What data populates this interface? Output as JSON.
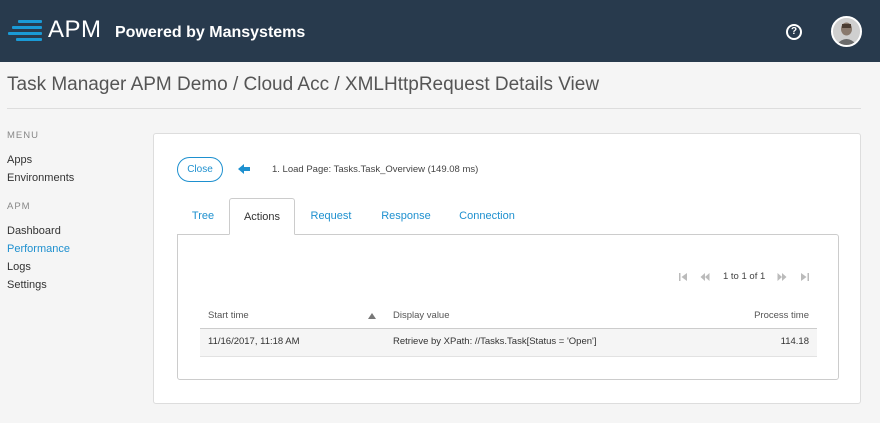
{
  "header": {
    "logo_text": "APM",
    "tagline": "Powered by Mansystems",
    "help_icon": "?",
    "brand_color": "#283a4d",
    "accent_color": "#1a9ad6"
  },
  "page": {
    "title": "Task Manager APM Demo / Cloud Acc / XMLHttpRequest Details View"
  },
  "sidebar": {
    "sections": [
      {
        "heading": "MENU",
        "items": [
          "Apps",
          "Environments"
        ]
      },
      {
        "heading": "APM",
        "items": [
          "Dashboard",
          "Performance",
          "Logs",
          "Settings"
        ]
      }
    ],
    "active_item": "Performance"
  },
  "details": {
    "close_label": "Close",
    "breadcrumb": "1. Load Page: Tasks.Task_Overview (149.08 ms)",
    "tabs": [
      "Tree",
      "Actions",
      "Request",
      "Response",
      "Connection"
    ],
    "active_tab": "Actions",
    "pager": {
      "text": "1 to 1 of 1"
    },
    "table": {
      "columns": [
        "Start time",
        "Display value",
        "Process time"
      ],
      "sorted_column": "Start time",
      "sort_direction": "ascending",
      "rows": [
        {
          "start_time": "11/16/2017, 11:18 AM",
          "display_value": "Retrieve by XPath: //Tasks.Task[Status = 'Open']",
          "process_time": "114.18"
        }
      ]
    }
  }
}
